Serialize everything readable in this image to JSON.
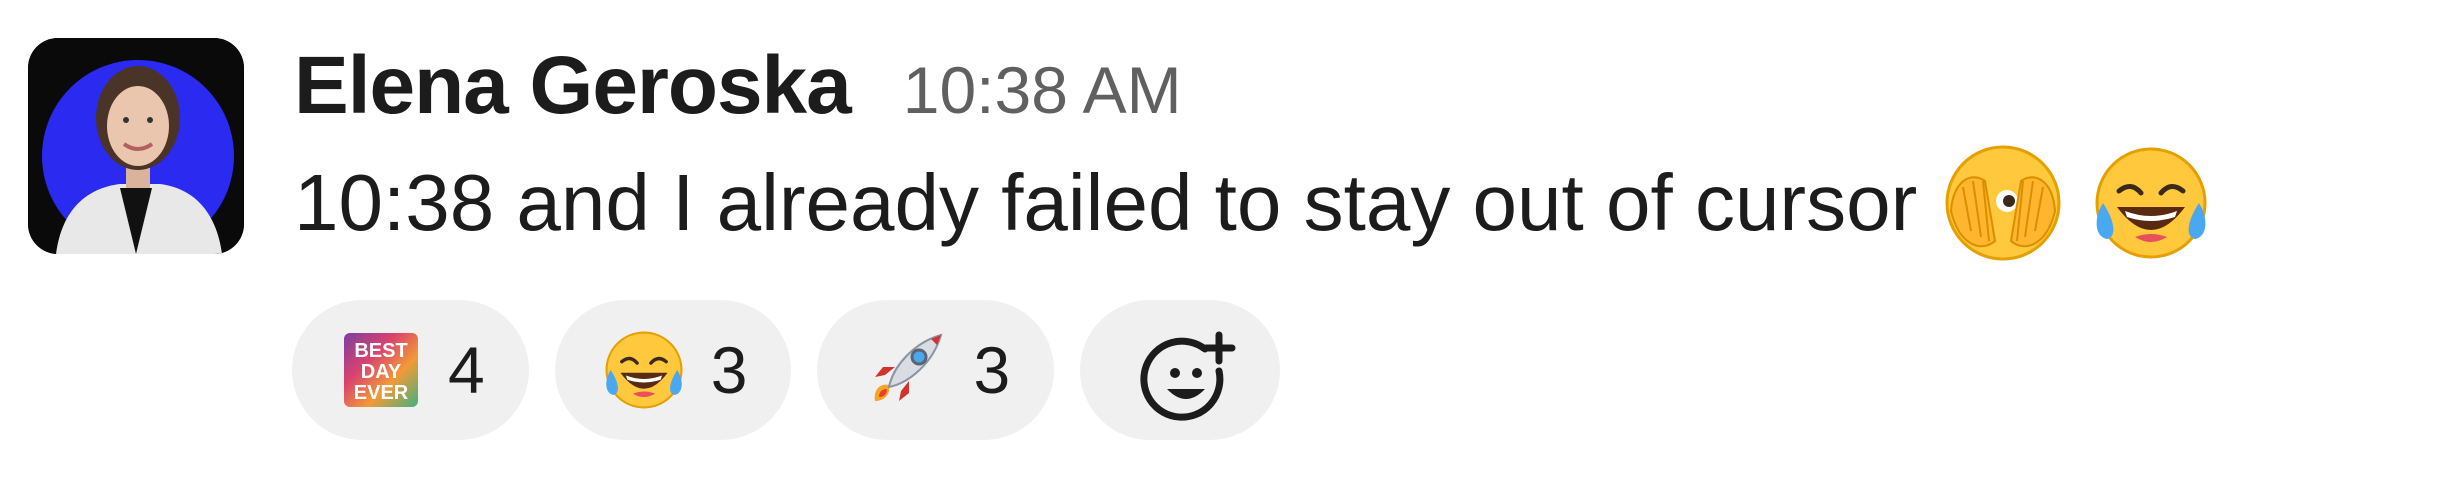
{
  "message": {
    "author": "Elena Geroska",
    "timestamp": "10:38 AM",
    "text": "10:38 and I already failed to stay out of cursor",
    "inline_emojis": [
      "face-with-open-eyes-and-hand-over-mouth-icon",
      "face-with-tears-of-joy-icon"
    ]
  },
  "reactions": [
    {
      "emoji": "best-day-ever-icon",
      "emoji_text": [
        "BEST",
        "DAY",
        "EVER"
      ],
      "count": "4"
    },
    {
      "emoji": "face-with-tears-of-joy-icon",
      "count": "3"
    },
    {
      "emoji": "rocket-icon",
      "count": "3"
    }
  ],
  "add_reaction": {
    "icon": "add-reaction-icon"
  },
  "colors": {
    "text": "#1d1c1d",
    "timestamp": "#616061",
    "reaction_bg": "#f0f0f0",
    "avatar_bg": "#0a0a0a",
    "avatar_ring": "#2a2af0"
  }
}
